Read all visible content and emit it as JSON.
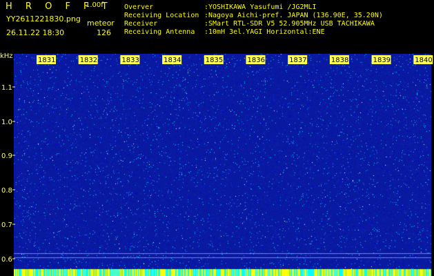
{
  "header": {
    "app_title": "H R O F F T",
    "version": "1.00f",
    "filename": "YY2611221830.png",
    "meteor_label": "meteor",
    "datetime": "26.11.22 18:30",
    "meteor_count": "126"
  },
  "station_info": {
    "labels": [
      "Overver",
      "Receiving Location",
      "Receiver",
      "Receiving Antenna"
    ],
    "values": [
      ":YOSHIKAWA Yasufumi /JG2MLI",
      ":Nagoya Aichi-pref. JAPAN (136.90E, 35.20N)",
      ":SMart RTL-SDR V5 52.905MHz USB TACHIKAWA",
      ":10mH 3el.YAGI Horizontal:ENE"
    ]
  },
  "waterfall": {
    "y_unit": "kHz",
    "y_ticks": [
      "1.1",
      "1.0",
      "0.9",
      "0.8",
      "0.7",
      "0.6"
    ],
    "time_labels": [
      "1831",
      "1832",
      "1833",
      "1834",
      "1835",
      "1836",
      "1837",
      "1838",
      "1839",
      "1840"
    ],
    "colors": {
      "background": "#0a1aa0",
      "noise": [
        "#0000c8",
        "#1030e0",
        "#00a0ff",
        "#00e0ff",
        "#ffffff"
      ],
      "bottom_band": [
        "#ffff00",
        "#00ffff"
      ],
      "label_box": "#ffff55",
      "axis_text": "#ffff66"
    }
  }
}
